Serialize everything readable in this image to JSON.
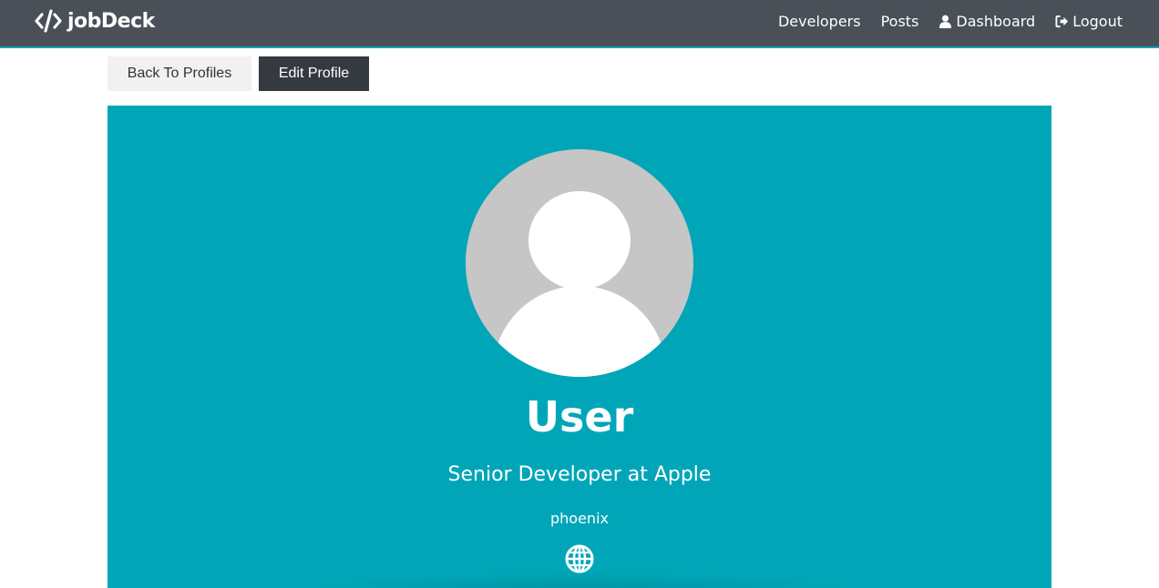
{
  "navbar": {
    "brand": "jobDeck",
    "brand_icon": "code-icon",
    "links": [
      {
        "label": "Developers"
      },
      {
        "label": "Posts"
      },
      {
        "label": "Dashboard",
        "icon": "user-icon"
      },
      {
        "label": "Logout",
        "icon": "sign-out-icon"
      }
    ],
    "background_color": "#495057",
    "accent_color": "#17a2b8"
  },
  "actions": {
    "back_label": "Back To Profiles",
    "edit_label": "Edit Profile"
  },
  "profile": {
    "name": "User",
    "headline": "Senior Developer at Apple",
    "location": "phoenix",
    "avatar_icon": "default-avatar",
    "website_icon": "globe-icon",
    "card_color": "#00a6b8"
  }
}
